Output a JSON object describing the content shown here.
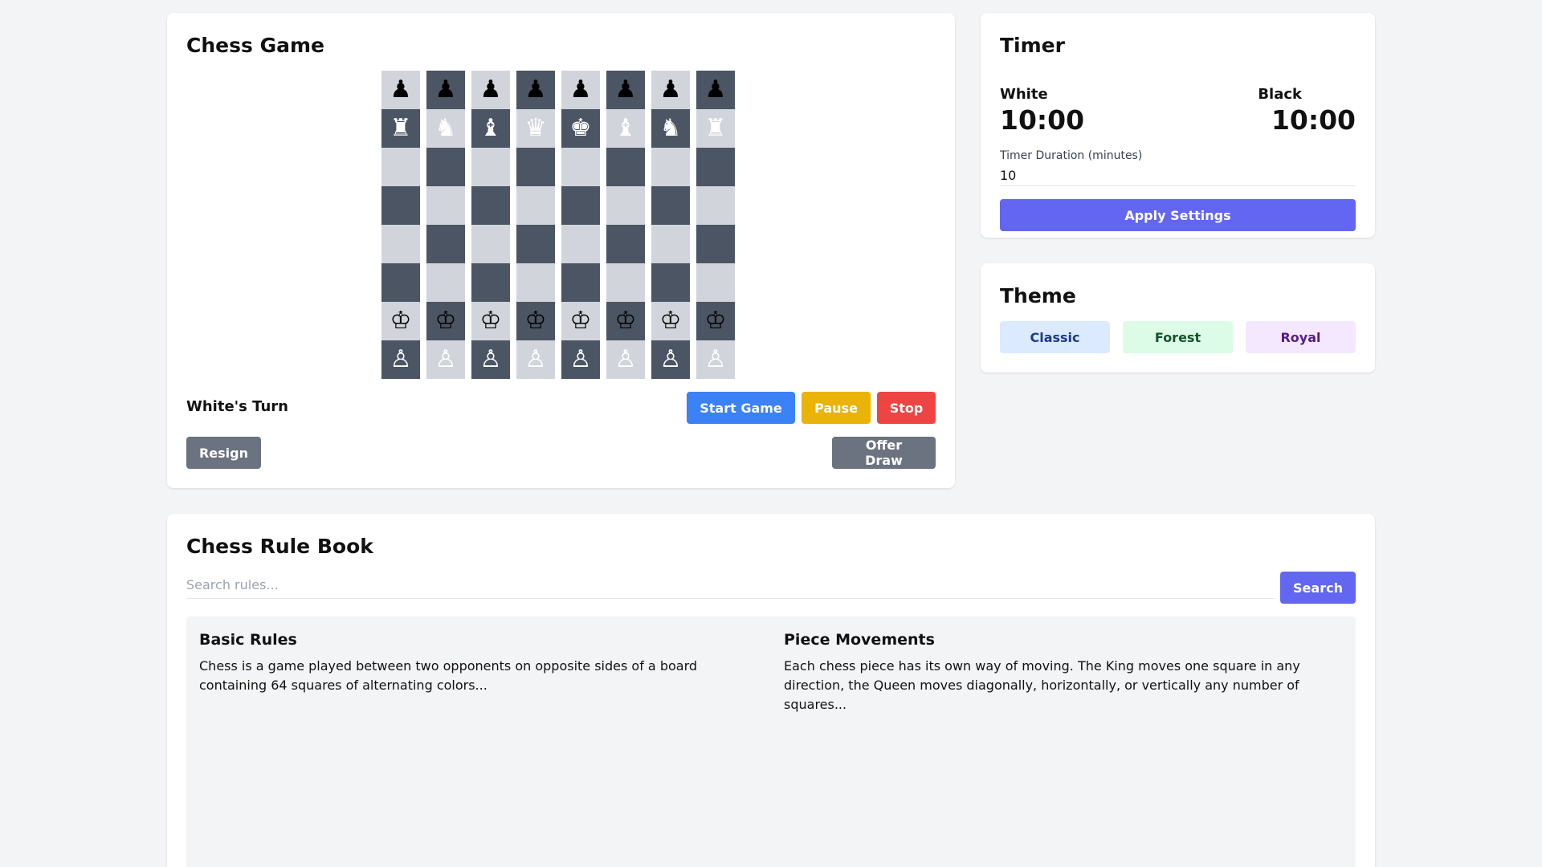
{
  "game": {
    "title": "Chess Game",
    "turn": "White's Turn",
    "buttons": {
      "start": "Start Game",
      "pause": "Pause",
      "stop": "Stop",
      "resign": "Resign",
      "offer_draw": "Offer Draw"
    },
    "board": [
      [
        "♟",
        "♟",
        "♟",
        "♟",
        "♟",
        "♟",
        "♟",
        "♟"
      ],
      [
        "♜",
        "♞",
        "♝",
        "♛",
        "♚",
        "♝",
        "♞",
        "♜"
      ],
      [
        "",
        "",
        "",
        "",
        "",
        "",
        "",
        ""
      ],
      [
        "",
        "",
        "",
        "",
        "",
        "",
        "",
        ""
      ],
      [
        "",
        "",
        "",
        "",
        "",
        "",
        "",
        ""
      ],
      [
        "",
        "",
        "",
        "",
        "",
        "",
        "",
        ""
      ],
      [
        "♔",
        "♔",
        "♔",
        "♔",
        "♔",
        "♔",
        "♔",
        "♔"
      ],
      [
        "♙",
        "♙",
        "♙",
        "♙",
        "♙",
        "♙",
        "♙",
        "♙"
      ]
    ],
    "piece_colors": [
      [
        "black",
        "black",
        "black",
        "black",
        "black",
        "black",
        "black",
        "black"
      ],
      [
        "white",
        "white",
        "white",
        "white",
        "white",
        "white",
        "white",
        "white"
      ],
      [
        "",
        "",
        "",
        "",
        "",
        "",
        "",
        ""
      ],
      [
        "",
        "",
        "",
        "",
        "",
        "",
        "",
        ""
      ],
      [
        "",
        "",
        "",
        "",
        "",
        "",
        "",
        ""
      ],
      [
        "",
        "",
        "",
        "",
        "",
        "",
        "",
        ""
      ],
      [
        "black",
        "black",
        "black",
        "black",
        "black",
        "black",
        "black",
        "black"
      ],
      [
        "white",
        "white",
        "white",
        "white",
        "white",
        "white",
        "white",
        "white"
      ]
    ]
  },
  "timer": {
    "title": "Timer",
    "white_label": "White",
    "white_time": "10:00",
    "black_label": "Black",
    "black_time": "10:00",
    "duration_label": "Timer Duration (minutes)",
    "duration_value": "10",
    "apply_label": "Apply Settings"
  },
  "theme": {
    "title": "Theme",
    "options": [
      "Classic",
      "Forest",
      "Royal"
    ]
  },
  "rulebook": {
    "title": "Chess Rule Book",
    "search_placeholder": "Search rules...",
    "search_label": "Search",
    "rules": [
      {
        "title": "Basic Rules",
        "text": "Chess is a game played between two opponents on opposite sides of a board containing 64 squares of alternating colors..."
      },
      {
        "title": "Piece Movements",
        "text": "Each chess piece has its own way of moving. The King moves one square in any direction, the Queen moves diagonally, horizontally, or vertically any number of squares..."
      }
    ]
  },
  "colors": {
    "light_square": "#d1d5db",
    "dark_square": "#4b5563",
    "start": "#3b82f6",
    "pause": "#eab308",
    "stop": "#ef4444",
    "neutral": "#6b7280",
    "accent": "#6366f1"
  }
}
